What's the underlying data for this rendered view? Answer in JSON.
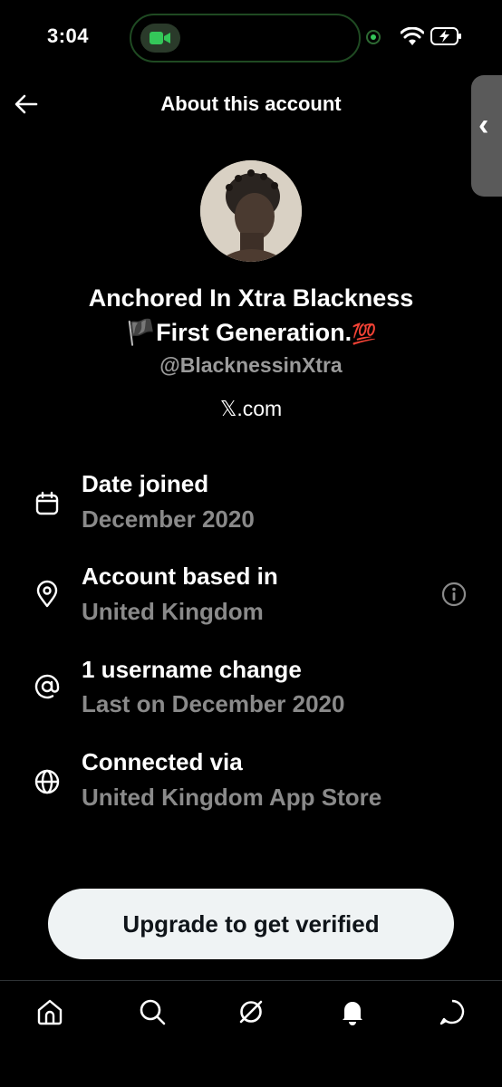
{
  "status_bar": {
    "time": "3:04",
    "icons": [
      "facetime-icon",
      "camera-indicator-icon",
      "wifi-icon",
      "battery-charging-icon"
    ]
  },
  "header": {
    "title": "About this account",
    "back_icon": "arrow-left-icon"
  },
  "profile": {
    "name_line1": "Anchored In Xtra Blackness",
    "name_line2_emoji": "🏴",
    "name_line2": "First Generation.",
    "name_line2_suffix": "💯",
    "handle": "@BlacknessinXtra",
    "site": "𝕏.com"
  },
  "details": [
    {
      "icon": "calendar-icon",
      "label": "Date joined",
      "value": "December 2020"
    },
    {
      "icon": "location-pin-icon",
      "label": "Account based in",
      "value": "United Kingdom"
    },
    {
      "icon": "at-sign-icon",
      "label": "1 username change",
      "value": "Last on December 2020"
    },
    {
      "icon": "globe-icon",
      "label": "Connected via",
      "value": "United Kingdom App Store"
    }
  ],
  "upgrade_button": {
    "label": "Upgrade to get verified"
  },
  "bottom_nav": [
    "home-icon",
    "search-icon",
    "grok-icon",
    "notifications-icon",
    "messages-icon"
  ],
  "colors": {
    "background": "#000000",
    "secondary_text": "#8a8a8a",
    "button_bg": "#eff3f4",
    "green": "#34c759"
  }
}
